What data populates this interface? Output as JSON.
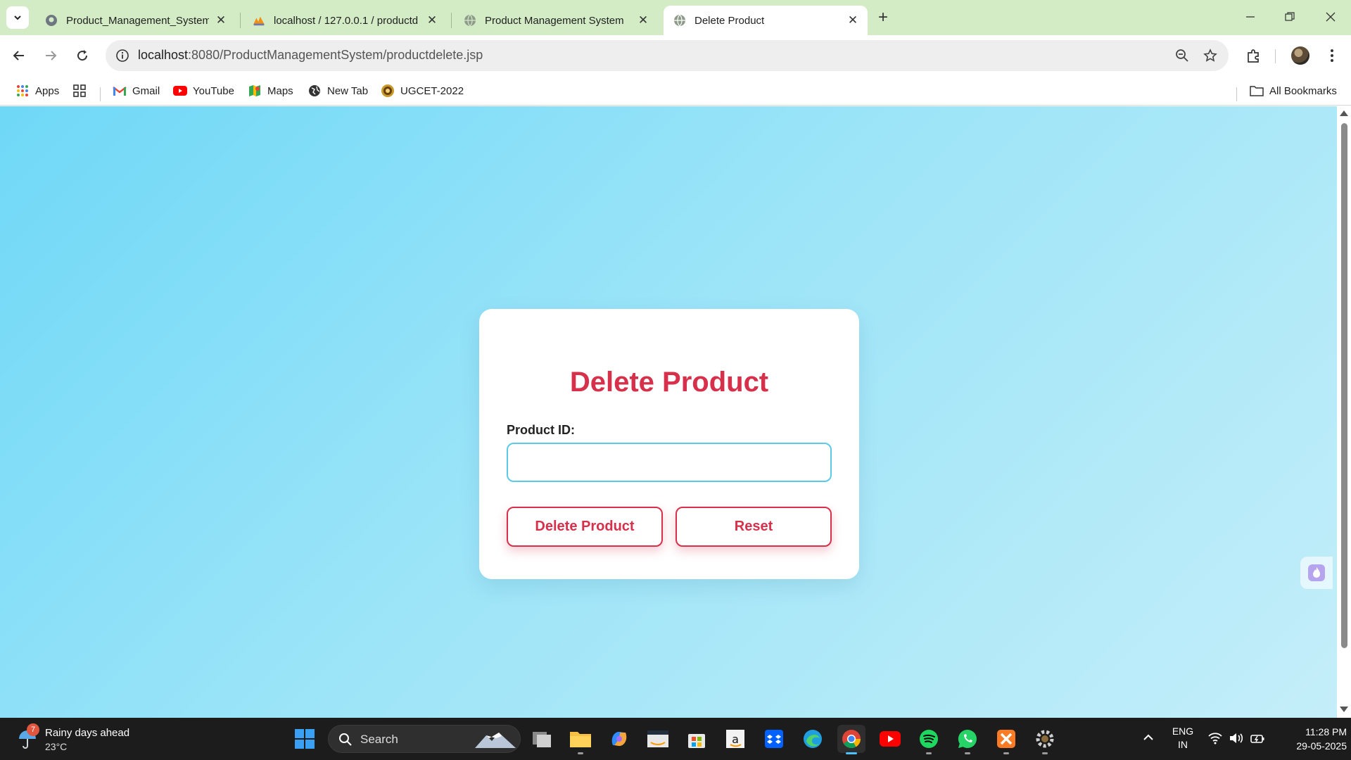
{
  "browser": {
    "tabs": [
      {
        "title": "Product_Management_System_",
        "active": false
      },
      {
        "title": "localhost / 127.0.0.1 / productd",
        "active": false
      },
      {
        "title": "Product Management System",
        "active": false
      },
      {
        "title": "Delete Product",
        "active": true
      }
    ],
    "close_glyph": "✕",
    "new_tab_glyph": "+",
    "url_host": "localhost",
    "url_path": ":8080/ProductManagementSystem/productdelete.jsp"
  },
  "bookmarks": {
    "items": [
      "Apps",
      "Gmail",
      "YouTube",
      "Maps",
      "New Tab",
      "UGCET-2022"
    ],
    "all_bookmarks": "All Bookmarks"
  },
  "page": {
    "title": "Delete Product",
    "field_label": "Product ID:",
    "field_value": "",
    "delete_button": "Delete Product",
    "reset_button": "Reset"
  },
  "taskbar": {
    "weather_badge": "7",
    "weather_title": "Rainy days ahead",
    "weather_temp": "23°C",
    "search_label": "Search",
    "lang_line1": "ENG",
    "lang_line2": "IN",
    "time": "11:28 PM",
    "date": "29-05-2025"
  },
  "colors": {
    "accent": "#d6304a",
    "input_border": "#5cc9e6",
    "tabstrip": "#d3ecc6",
    "background_start": "#6fd8f7",
    "background_end": "#c4eef9"
  }
}
